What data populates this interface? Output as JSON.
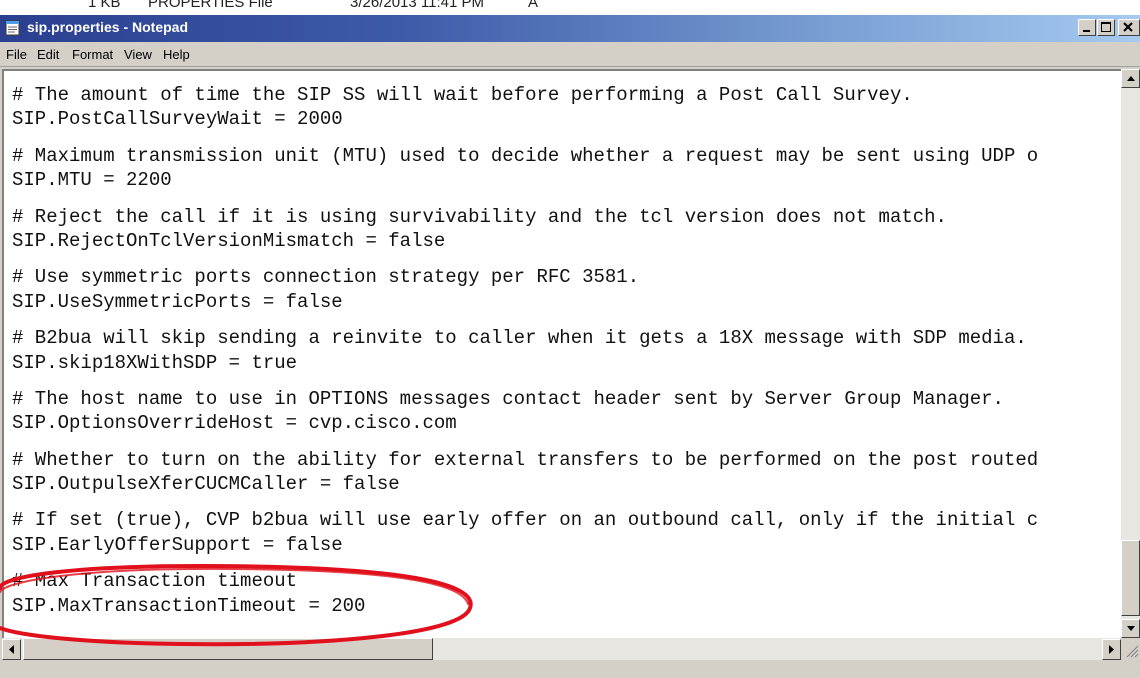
{
  "background_window": {
    "size": "1 KB",
    "type": "PROPERTIES File",
    "date": "3/26/2013 11:41 PM",
    "attr": "A"
  },
  "window": {
    "title": "sip.properties - Notepad",
    "app_icon": "notepad-icon",
    "controls": [
      "minimize-icon",
      "maximize-icon",
      "close-icon"
    ]
  },
  "menu": {
    "file": "File",
    "edit": "Edit",
    "format": "Format",
    "view": "View",
    "help": "Help"
  },
  "editor": {
    "lines": [
      "# The amount of time the SIP SS will wait before performing a Post Call Survey.",
      "SIP.PostCallSurveyWait = 2000",
      "# Maximum transmission unit (MTU) used to decide whether a request may be sent using UDP o",
      "SIP.MTU = 2200",
      "# Reject the call if it is using survivability and the tcl version does not match.",
      "SIP.RejectOnTclVersionMismatch = false",
      "# Use symmetric ports connection strategy per RFC 3581.",
      "SIP.UseSymmetricPorts = false",
      "# B2bua will skip sending a reinvite to caller when it gets a 18X message with SDP media.",
      "SIP.skip18XWithSDP = true",
      "# The host name to use in OPTIONS messages contact header sent by Server Group Manager.",
      "SIP.OptionsOverrideHost = cvp.cisco.com",
      "# Whether to turn on the ability for external transfers to be performed on the post routed",
      "SIP.OutpulseXferCUCMCaller = false",
      "# If set (true), CVP b2bua will use early offer on an outbound call, only if the initial c",
      "SIP.EarlyOfferSupport = false",
      "# Max Transaction timeout",
      "SIP.MaxTransactionTimeout = 200"
    ]
  },
  "colors": {
    "titlebar_start": "#2a3f8f",
    "titlebar_end": "#a6caf0",
    "annotation": "#e0101c"
  }
}
